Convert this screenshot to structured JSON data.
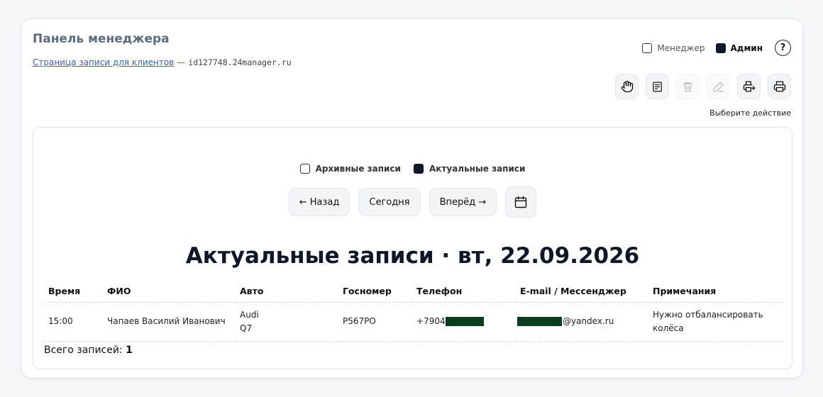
{
  "header": {
    "title": "Панель менеджера",
    "client_link": "Страница записи для клиентов",
    "separator": "—",
    "domain": "id127748.24manager.ru"
  },
  "roles": {
    "manager_label": "Менеджер",
    "manager_checked": false,
    "admin_label": "Админ",
    "admin_checked": true,
    "help_label": "?"
  },
  "toolbar": {
    "buttons": [
      {
        "icon": "hand-icon",
        "enabled": true
      },
      {
        "icon": "document-icon",
        "enabled": true
      },
      {
        "icon": "trash-icon",
        "enabled": false
      },
      {
        "icon": "pencil-icon",
        "enabled": false
      },
      {
        "icon": "print-add-icon",
        "enabled": true
      },
      {
        "icon": "printer-icon",
        "enabled": true
      }
    ],
    "hint": "Выберите действие"
  },
  "filters": {
    "archive_label": "Архивные записи",
    "archive_checked": false,
    "current_label": "Актуальные записи",
    "current_checked": true
  },
  "nav": {
    "back": "← Назад",
    "today": "Сегодня",
    "forward": "Вперёд →",
    "calendar_icon": "calendar-icon"
  },
  "main_title": "Актуальные записи · вт, 22.09.2026",
  "table": {
    "columns": [
      "Время",
      "ФИО",
      "Авто",
      "Госномер",
      "Телефон",
      "E-mail / Мессенджер",
      "Примечания"
    ],
    "rows": [
      {
        "time": "15:00",
        "name": "Чапаев Василий Иванович",
        "car_line1": "Audi",
        "car_line2": "Q7",
        "plate": "Р567РО",
        "phone_prefix": "+7904",
        "email_suffix": "@yandex.ru",
        "note": "Нужно отбалансировать колёса"
      }
    ]
  },
  "total": {
    "label": "Всего записей:",
    "value": "1"
  },
  "colors": {
    "accent_dark": "#0f172a",
    "link": "#2b63d9",
    "redaction": "#083d1d"
  }
}
